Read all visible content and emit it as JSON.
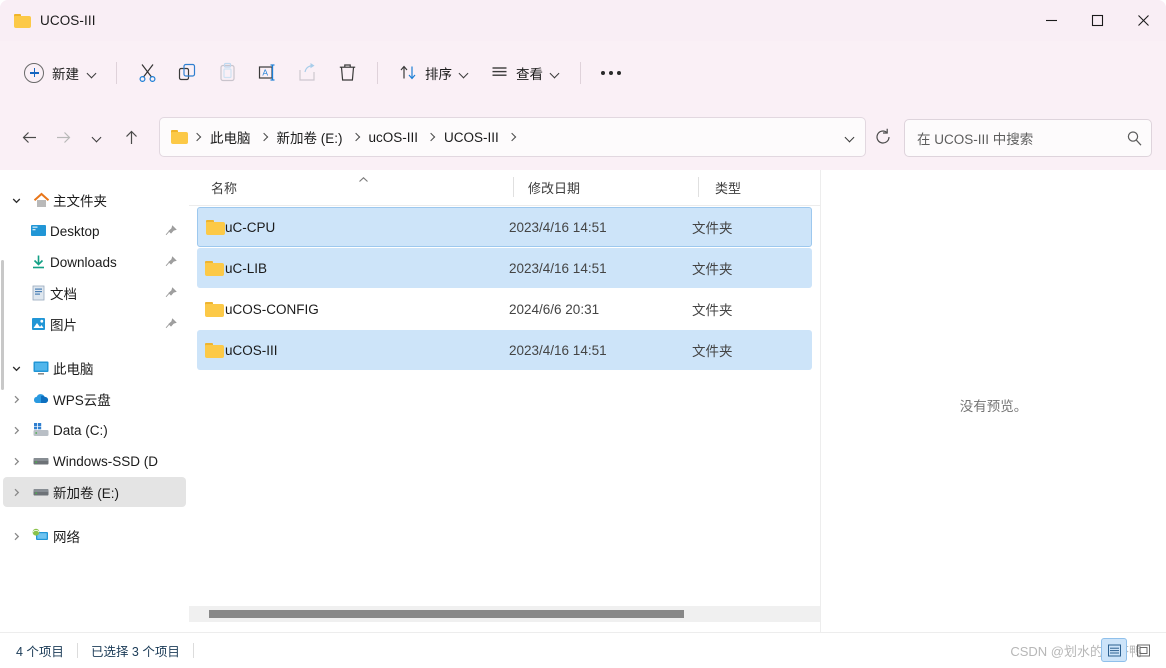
{
  "window": {
    "title": "UCOS-III",
    "controls": {
      "minimize": "—",
      "maximize": "□",
      "close": "✕"
    }
  },
  "toolbar": {
    "new_label": "新建",
    "cut_label": "剪切",
    "copy_label": "复制",
    "paste_label": "粘贴",
    "rename_label": "重命名",
    "share_label": "共享",
    "delete_label": "删除",
    "sort_label": "排序",
    "view_label": "查看",
    "more_label": "查看更多"
  },
  "navigation": {
    "back": "后退",
    "forward": "前进",
    "recent": "最近的位置",
    "up": "向上",
    "refresh": "刷新",
    "address_dropdown": "历史记录"
  },
  "breadcrumb": {
    "items": [
      {
        "label": "此电脑"
      },
      {
        "label": "新加卷 (E:)"
      },
      {
        "label": "ucOS-III"
      },
      {
        "label": "UCOS-III"
      }
    ]
  },
  "search": {
    "placeholder": "在 UCOS-III 中搜索",
    "value": ""
  },
  "sidebar": {
    "items": [
      {
        "label": "主文件夹",
        "icon": "home-icon",
        "expander": "down",
        "indent": false,
        "pinned": false,
        "selected": false
      },
      {
        "label": "Desktop",
        "icon": "desktop-icon",
        "expander": "none",
        "indent": true,
        "pinned": true,
        "selected": false
      },
      {
        "label": "Downloads",
        "icon": "downloads-icon",
        "expander": "none",
        "indent": true,
        "pinned": true,
        "selected": false
      },
      {
        "label": "文档",
        "icon": "documents-icon",
        "expander": "none",
        "indent": true,
        "pinned": true,
        "selected": false
      },
      {
        "label": "图片",
        "icon": "pictures-icon",
        "expander": "none",
        "indent": true,
        "pinned": true,
        "selected": false
      },
      {
        "label": "此电脑",
        "icon": "this-pc-icon",
        "expander": "down",
        "indent": false,
        "pinned": false,
        "selected": false
      },
      {
        "label": "WPS云盘",
        "icon": "cloud-icon",
        "expander": "right",
        "indent": false,
        "pinned": false,
        "selected": false
      },
      {
        "label": "Data (C:)",
        "icon": "system-drive-icon",
        "expander": "right",
        "indent": false,
        "pinned": false,
        "selected": false
      },
      {
        "label": "Windows-SSD (D",
        "icon": "drive-icon",
        "expander": "right",
        "indent": false,
        "pinned": false,
        "selected": false
      },
      {
        "label": "新加卷 (E:)",
        "icon": "drive-icon",
        "expander": "right",
        "indent": false,
        "pinned": false,
        "selected": true
      },
      {
        "label": "网络",
        "icon": "network-icon",
        "expander": "right",
        "indent": false,
        "pinned": false,
        "selected": false
      }
    ]
  },
  "filelist": {
    "columns": [
      {
        "label": "名称",
        "sort": "asc"
      },
      {
        "label": "修改日期",
        "sort": "none"
      },
      {
        "label": "类型",
        "sort": "none"
      }
    ],
    "rows": [
      {
        "name": "uC-CPU",
        "date": "2023/4/16 14:51",
        "type": "文件夹",
        "selected": true,
        "focused": true
      },
      {
        "name": "uC-LIB",
        "date": "2023/4/16 14:51",
        "type": "文件夹",
        "selected": true,
        "focused": false
      },
      {
        "name": "uCOS-CONFIG",
        "date": "2024/6/6 20:31",
        "type": "文件夹",
        "selected": false,
        "focused": false
      },
      {
        "name": "uCOS-III",
        "date": "2023/4/16 14:51",
        "type": "文件夹",
        "selected": true,
        "focused": false
      }
    ]
  },
  "preview": {
    "message": "没有预览。"
  },
  "status": {
    "item_count": "4 个项目",
    "selection": "已选择 3 个项目",
    "view_details": "详细信息",
    "view_large_icons": "大图标"
  },
  "watermark": {
    "text": "CSDN @划水的达芬鸭"
  },
  "colors": {
    "titlebar": "#f9eef5",
    "toolbar": "#faf0f6",
    "selection": "#cde4f9",
    "accent": "#1565c0",
    "folder": "#fcc947",
    "status_text": "#1b3b57"
  }
}
